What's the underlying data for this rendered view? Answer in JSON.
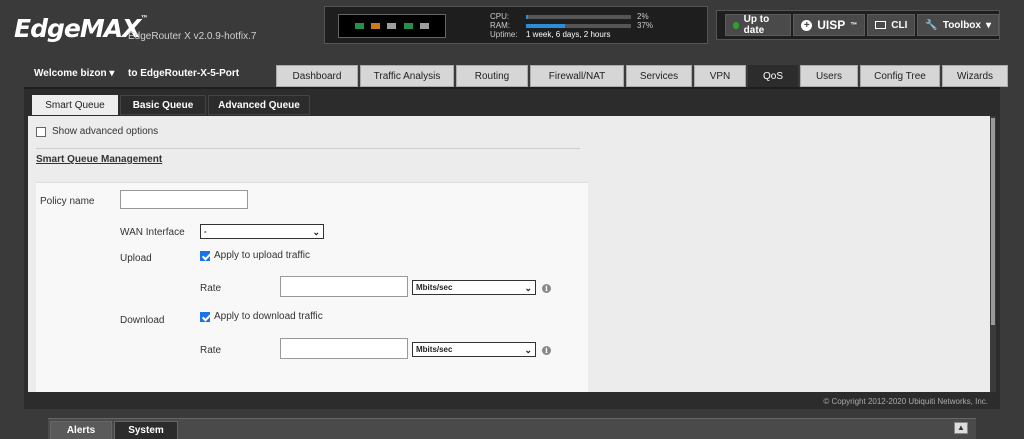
{
  "header": {
    "logo": "EdgeMAX",
    "logo_tm": "™",
    "version": "EdgeRouter X v2.0.9-hotfix.7",
    "ports": [
      "#2ca050",
      "#e08a20",
      "#b0b0b0",
      "#2ca050",
      "#b0b0b0"
    ],
    "cpu_label": "CPU:",
    "cpu_value": "2%",
    "cpu_fraction": 0.02,
    "ram_label": "RAM:",
    "ram_value": "37%",
    "ram_fraction": 0.37,
    "uptime_label": "Uptime:",
    "uptime_value": "1 week, 6 days, 2 hours"
  },
  "toolbar": {
    "up_to_date": "Up to date",
    "uisp": "UISP",
    "uisp_tm": "™",
    "cli": "CLI",
    "toolbox": "Toolbox"
  },
  "nav": {
    "welcome": "Welcome bizon",
    "router": "to EdgeRouter-X-5-Port",
    "tabs": [
      "Dashboard",
      "Traffic Analysis",
      "Routing",
      "Firewall/NAT",
      "Services",
      "VPN",
      "QoS",
      "Users",
      "Config Tree",
      "Wizards"
    ],
    "active_tab": "QoS"
  },
  "subtabs": [
    "Smart Queue",
    "Basic Queue",
    "Advanced Queue"
  ],
  "form": {
    "show_advanced": "Show advanced options",
    "section_title": "Smart Queue Management",
    "policy_name_label": "Policy name",
    "policy_name_value": "",
    "wan_label": "WAN Interface",
    "wan_value": "-",
    "upload_label": "Upload",
    "upload_check": "Apply to upload traffic",
    "rate_label": "Rate",
    "upload_rate_value": "",
    "upload_unit": "Mbits/sec",
    "download_label": "Download",
    "download_check": "Apply to download traffic",
    "download_rate_value": "",
    "download_unit": "Mbits/sec"
  },
  "footer": {
    "copyright": "© Copyright 2012-2020 Ubiquiti Networks, Inc."
  },
  "bottom": {
    "alerts": "Alerts",
    "system": "System"
  }
}
